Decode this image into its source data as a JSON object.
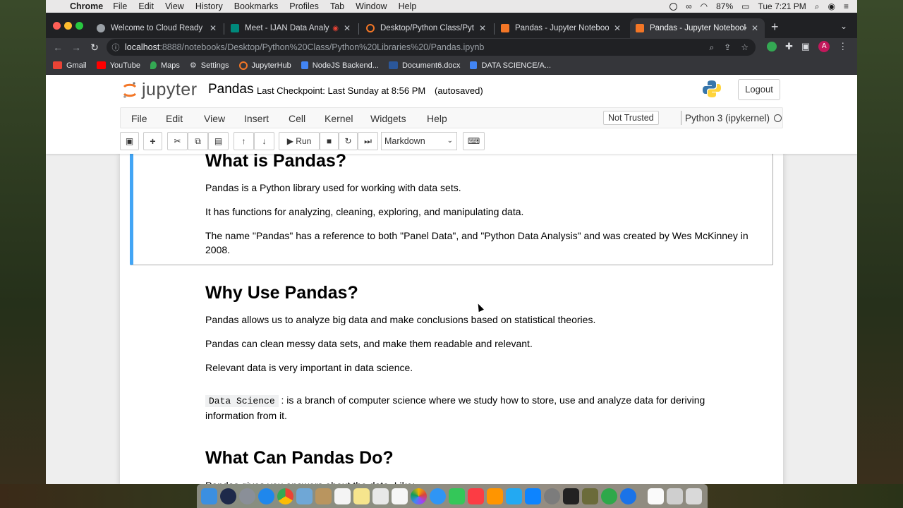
{
  "menubar": {
    "app_name": "Chrome",
    "items": [
      "File",
      "Edit",
      "View",
      "History",
      "Bookmarks",
      "Profiles",
      "Tab",
      "Window",
      "Help"
    ],
    "battery": "87%",
    "clock": "Tue 7:21 PM"
  },
  "tabs": [
    {
      "title": "Welcome to Cloud Ready Skills",
      "icon": "globe-icon",
      "color": "#9aa0a6"
    },
    {
      "title": "Meet - IJAN Data Analysis",
      "icon": "meet-icon",
      "color": "#00897b"
    },
    {
      "title": "Desktop/Python Class/Python Li",
      "icon": "jupyter-icon",
      "color": "#f37626"
    },
    {
      "title": "Pandas - Jupyter Notebook",
      "icon": "jupyter-icon",
      "color": "#f37626"
    },
    {
      "title": "Pandas - Jupyter Notebook",
      "icon": "jupyter-icon",
      "color": "#f37626"
    }
  ],
  "address": {
    "host": "localhost",
    "path": ":8888/notebooks/Desktop/Python%20Class/Python%20Libraries%20/Pandas.ipynb"
  },
  "bookmarks": [
    {
      "label": "Gmail",
      "color": "#ea4335"
    },
    {
      "label": "YouTube",
      "color": "#ff0000"
    },
    {
      "label": "Maps",
      "color": "#34a853"
    },
    {
      "label": "Settings",
      "color": "#9aa0a6"
    },
    {
      "label": "JupyterHub",
      "color": "#f37626"
    },
    {
      "label": "NodeJS Backend...",
      "color": "#4285f4"
    },
    {
      "label": "Document6.docx",
      "color": "#2b579a"
    },
    {
      "label": "DATA SCIENCE/A...",
      "color": "#4285f4"
    }
  ],
  "jupyter": {
    "logo_text": "jupyter",
    "notebook_name": "Pandas",
    "checkpoint": "Last Checkpoint: Last Sunday at 8:56 PM",
    "autosaved": "(autosaved)",
    "logout": "Logout",
    "menu": [
      "File",
      "Edit",
      "View",
      "Insert",
      "Cell",
      "Kernel",
      "Widgets",
      "Help"
    ],
    "trust": "Not Trusted",
    "kernel": "Python 3 (ipykernel)",
    "run_label": "Run",
    "cell_type": "Markdown"
  },
  "cells": {
    "what_heading": "What is Pandas?",
    "what_p1": "Pandas is a Python library used for working with data sets.",
    "what_p2": "It has functions for analyzing, cleaning, exploring, and manipulating data.",
    "what_p3": "The name \"Pandas\" has a reference to both \"Panel Data\", and \"Python Data Analysis\" and was created by Wes McKinney in 2008.",
    "why_heading": "Why Use Pandas?",
    "why_p1": "Pandas allows us to analyze big data and make conclusions based on statistical theories.",
    "why_p2": "Pandas can clean messy data sets, and make them readable and relevant.",
    "why_p3": "Relevant data is very important in data science.",
    "ds_code": "Data Science",
    "ds_text": ": is a branch of computer science where we study how to store, use and analyze data for deriving information from it.",
    "do_heading": "What Can Pandas Do?",
    "do_p1": "Pandas gives you answers about the data. Like:"
  }
}
